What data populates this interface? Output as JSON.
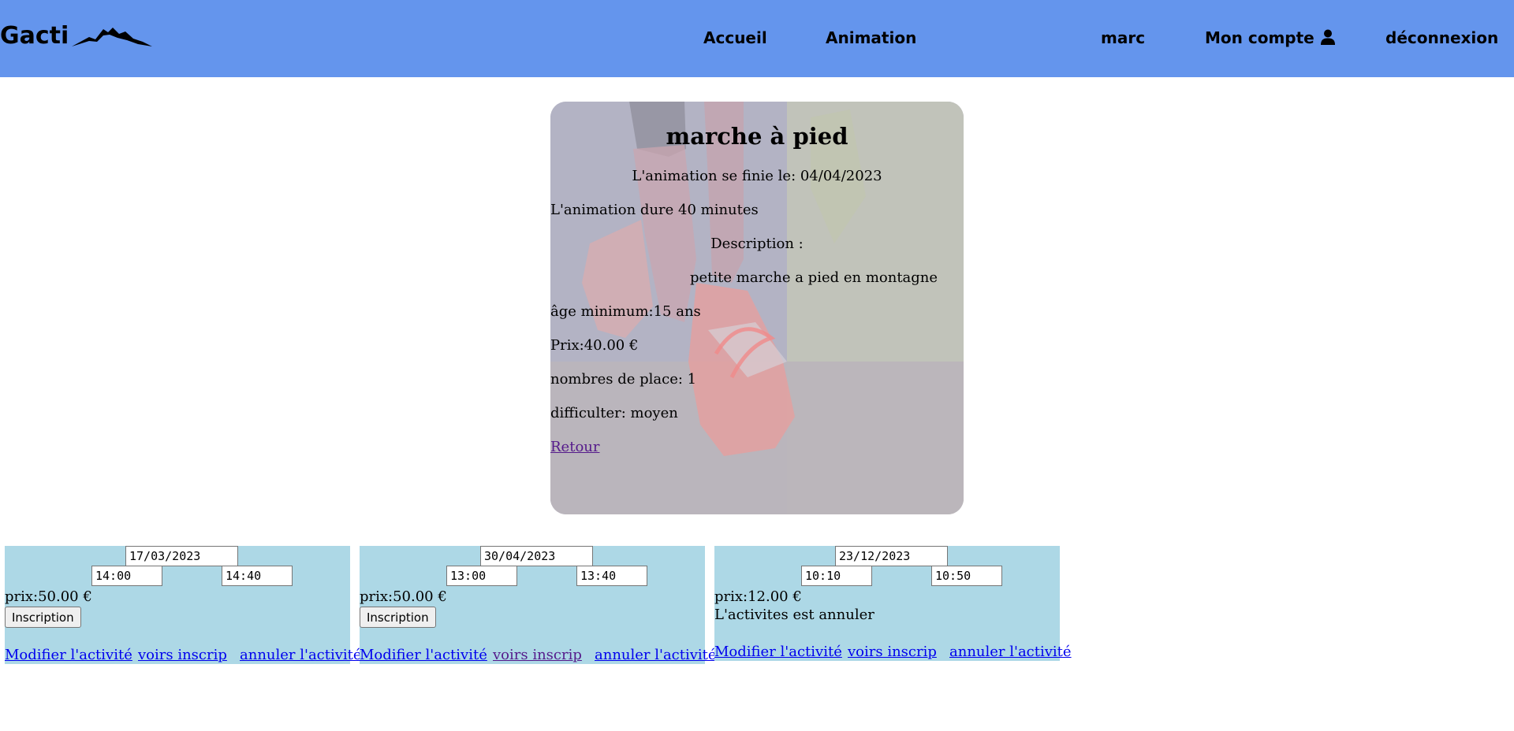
{
  "header": {
    "brand": "Gacti",
    "nav": {
      "home": "Accueil",
      "animation": "Animation",
      "user": "marc",
      "account": "Mon compte",
      "logout": "déconnexion"
    },
    "icons": {
      "logo": "mountain-icon",
      "account": "user-icon"
    }
  },
  "activity": {
    "title": "marche à pied",
    "end_date": "L'animation se finie le: 04/04/2023",
    "duration": "L'animation dure 40 minutes",
    "description_label": "Description :",
    "description": "petite marche a pied en montagne",
    "min_age": "âge minimum:15 ans",
    "price": "Prix:40.00 €",
    "places": "nombres de place: 1",
    "difficulty": "difficulter: moyen",
    "back": "Retour"
  },
  "sessions": [
    {
      "date": "17/03/2023",
      "start": "14:00",
      "end": "14:40",
      "price": "prix:50.00 €",
      "button": "Inscription",
      "status": "",
      "edit": "Modifier l'activité",
      "view": "voirs inscrip",
      "cancel": "annuler l'activité"
    },
    {
      "date": "30/04/2023",
      "start": "13:00",
      "end": "13:40",
      "price": "prix:50.00 €",
      "button": "Inscription",
      "status": "",
      "edit": "Modifier l'activité",
      "view": "voirs inscrip",
      "cancel": "annuler l'activité"
    },
    {
      "date": "23/12/2023",
      "start": "10:10",
      "end": "10:50",
      "price": "prix:12.00 €",
      "button": "",
      "status": "L'activites est annuler",
      "edit": "Modifier l'activité",
      "view": "voirs inscrip",
      "cancel": "annuler l'activité"
    }
  ],
  "colors": {
    "header_bg": "#6495ed",
    "session_bg": "#add8e6",
    "link": "#0000ee",
    "visited_link": "#551a8b"
  }
}
